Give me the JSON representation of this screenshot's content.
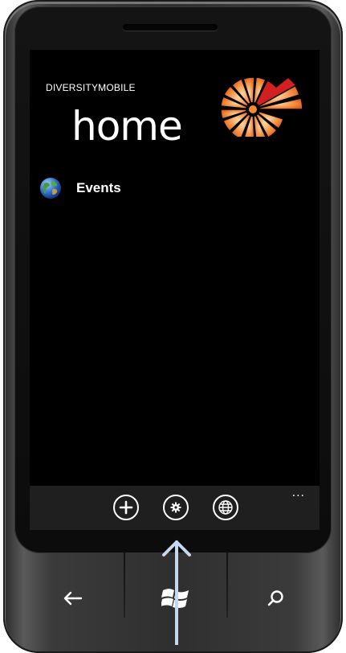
{
  "app": {
    "name": "DIVERSITYMOBILE",
    "page_title": "home"
  },
  "list": {
    "items": [
      {
        "label": "Events",
        "icon": "globe-icon"
      }
    ]
  },
  "app_bar": {
    "buttons": [
      {
        "icon": "add-icon"
      },
      {
        "icon": "settings-icon"
      },
      {
        "icon": "globe-icon"
      }
    ],
    "more": "..."
  },
  "hardware_buttons": [
    "back-icon",
    "windows-icon",
    "search-icon"
  ],
  "colors": {
    "background": "#000000",
    "app_bar": "#1f1f1f",
    "logo_orange": "#f07c2a",
    "logo_red": "#d21f1f",
    "arrow": "#c6d8ee"
  }
}
